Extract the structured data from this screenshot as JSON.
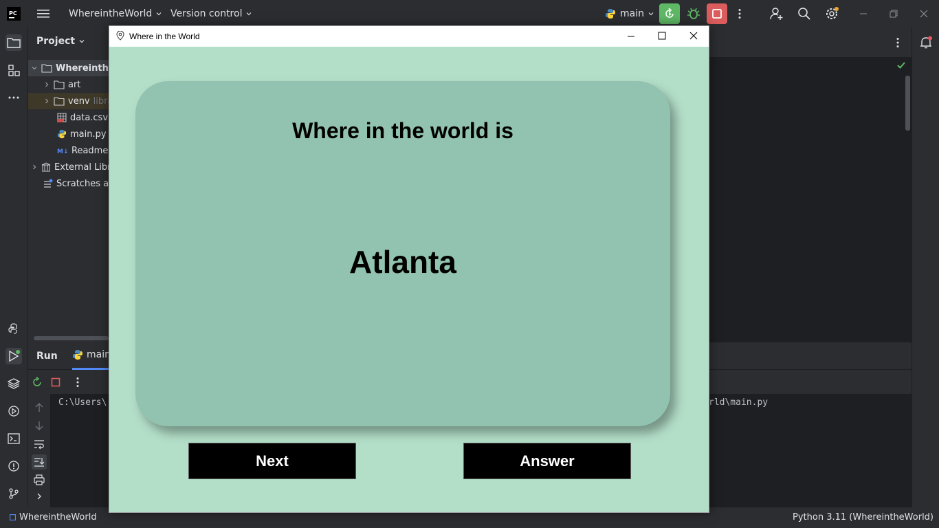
{
  "ide": {
    "project_name": "WhereintheWorld",
    "vcs_label": "Version control",
    "run_config": "main",
    "project_panel_title": "Project",
    "tree": [
      {
        "label": "WhereintheW",
        "note": ""
      },
      {
        "label": "art",
        "note": ""
      },
      {
        "label": "venv",
        "note": "libra"
      },
      {
        "label": "data.csv",
        "note": ""
      },
      {
        "label": "main.py",
        "note": ""
      },
      {
        "label": "Readme.r",
        "note": ""
      },
      {
        "label": "External Libr",
        "note": ""
      },
      {
        "label": "Scratches ar",
        "note": ""
      }
    ],
    "run_tab": "Run",
    "run_config_tab": "main",
    "console_left": "C:\\Users\\",
    "console_right": "rld\\main.py",
    "status_project": "WhereintheWorld",
    "status_interpreter": "Python 3.11 (WhereintheWorld)"
  },
  "app": {
    "window_title": "Where in the World",
    "prompt": "Where in the world is",
    "city": "Atlanta",
    "next_label": "Next",
    "answer_label": "Answer"
  },
  "colors": {
    "app_bg": "#b3dec8",
    "card_bg": "#92c2b0",
    "button_bg": "#000000",
    "run_green": "#5fb865",
    "stop_red": "#db5c5c"
  }
}
